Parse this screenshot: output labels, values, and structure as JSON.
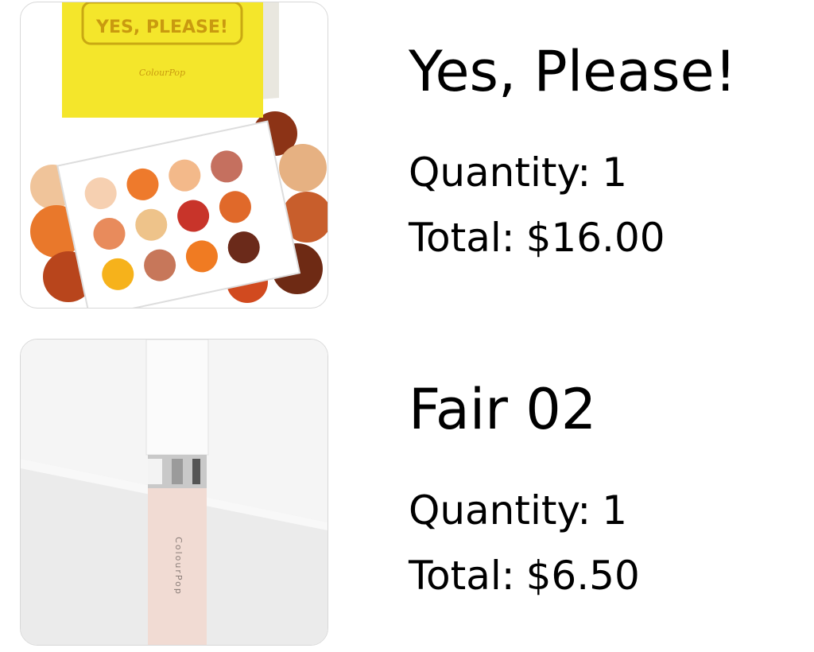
{
  "items": [
    {
      "name": "Yes, Please!",
      "quantity_label": "Quantity:",
      "quantity": "1",
      "total_label": "Total:",
      "total": "$16.00",
      "image": {
        "icon": "eyeshadow-palette-image",
        "box_text": "YES, PLEASE!",
        "brand_text": "ColourPop"
      }
    },
    {
      "name": "Fair 02",
      "quantity_label": "Quantity:",
      "quantity": "1",
      "total_label": "Total:",
      "total": "$6.50",
      "image": {
        "icon": "concealer-tube-image",
        "tube_text": "ColourPop"
      }
    }
  ],
  "colors": {
    "box_yellow": "#f4e62b",
    "orange": "#e9782b",
    "rust": "#b8451c",
    "peach": "#f3b98a",
    "tube_pink": "#f1dbd3"
  }
}
